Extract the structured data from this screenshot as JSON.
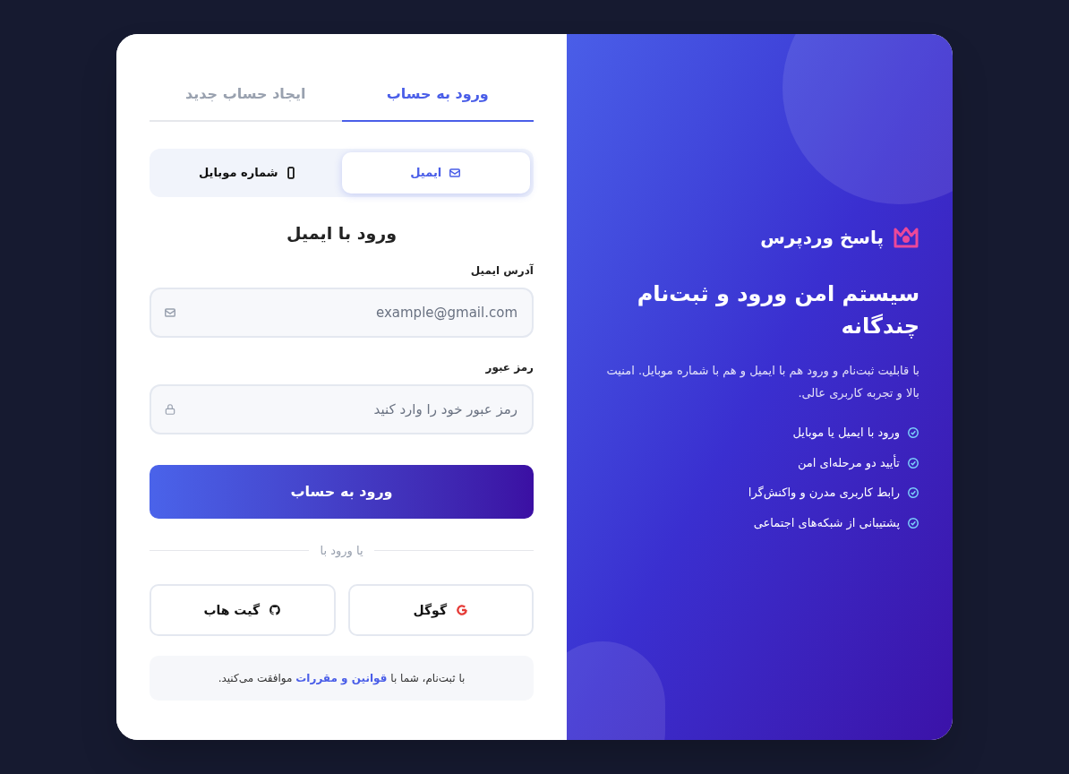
{
  "tabs": [
    {
      "label": "ورود به حساب",
      "selected": true
    },
    {
      "label": "ایجاد حساب جدید",
      "selected": false
    }
  ],
  "methods": [
    {
      "kind": "email",
      "label": "ایمیل",
      "selected": true
    },
    {
      "kind": "mobile",
      "label": "شماره موبایل",
      "selected": false
    }
  ],
  "form_title": "ورود با ایمیل",
  "fields": [
    {
      "kind": "email",
      "label": "آدرس ایمیل",
      "placeholder": "example@gmail.com"
    },
    {
      "kind": "password",
      "label": "رمز عبور",
      "placeholder": "رمز عبور خود را وارد کنید"
    }
  ],
  "submit": "ورود به حساب",
  "divider": "یا ورود با",
  "social": [
    {
      "kind": "google",
      "label": "گوگل"
    },
    {
      "kind": "github",
      "label": "گیت هاب"
    }
  ],
  "terms": {
    "before": "با ثبت‌نام، شما با",
    "link": "قوانین و مقررات",
    "after": "موافقت می‌کنید."
  },
  "brand": "پاسخ وردپرس",
  "headline": "سیستم امن ورود و ثبت‌نام چندگانه",
  "description": "با قابلیت ثبت‌نام و ورود هم با ایمیل و هم با شماره موبایل. امنیت بالا و تجربه کاربری عالی.",
  "features": [
    "ورود با ایمیل یا موبایل",
    "تأیید دو مرحله‌ای امن",
    "رابط کاربری مدرن و واکنش‌گرا",
    "پشتیبانی از شبکه‌های اجتماعی"
  ]
}
